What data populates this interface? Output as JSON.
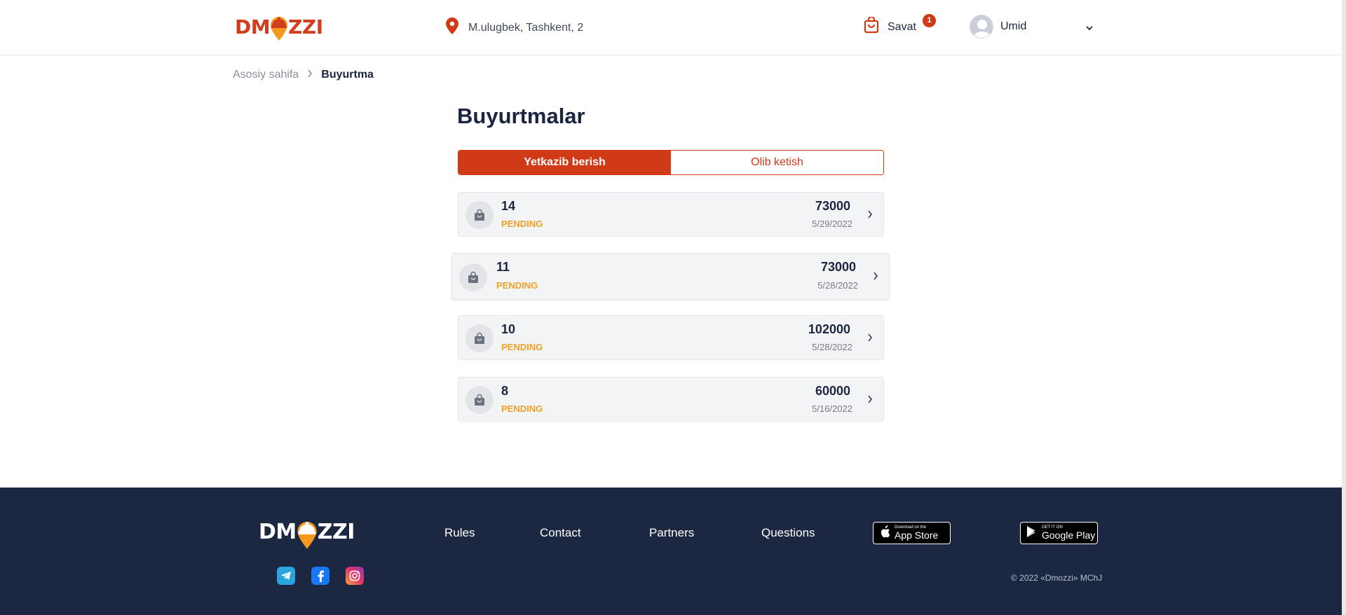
{
  "header": {
    "logo_text_left": "DM",
    "logo_text_right": "ZZI",
    "location": "M.ulugbek, Tashkent, 2",
    "cart_label": "Savat",
    "cart_count": "1",
    "user_name": "Umid"
  },
  "breadcrumb": {
    "home": "Asosiy sahifa",
    "current": "Buyurtma"
  },
  "page_title": "Buyurtmalar",
  "tabs": [
    {
      "label": "Yetkazib berish",
      "active": true
    },
    {
      "label": "Olib ketish",
      "active": false
    }
  ],
  "orders": [
    {
      "number": "14",
      "status": "PENDING",
      "price": "73000",
      "date": "5/29/2022"
    },
    {
      "number": "11",
      "status": "PENDING",
      "price": "73000",
      "date": "5/28/2022"
    },
    {
      "number": "10",
      "status": "PENDING",
      "price": "102000",
      "date": "5/28/2022"
    },
    {
      "number": "8",
      "status": "PENDING",
      "price": "60000",
      "date": "5/16/2022"
    }
  ],
  "footer": {
    "logo_text_left": "DM",
    "logo_text_right": "ZZI",
    "links": [
      "Rules",
      "Contact",
      "Partners",
      "Questions"
    ],
    "app_store_small": "Download on the",
    "app_store_big": "App Store",
    "google_play_small": "GET IT ON",
    "google_play_big": "Google Play",
    "social": [
      "telegram-icon",
      "facebook-icon",
      "instagram-icon"
    ],
    "copyright": "© 2022 «Dmozzi» MChJ"
  },
  "colors": {
    "brand": "#d13a17",
    "pending": "#f0a025",
    "footer_bg": "#1c2842",
    "text_dark": "#1b2540"
  }
}
